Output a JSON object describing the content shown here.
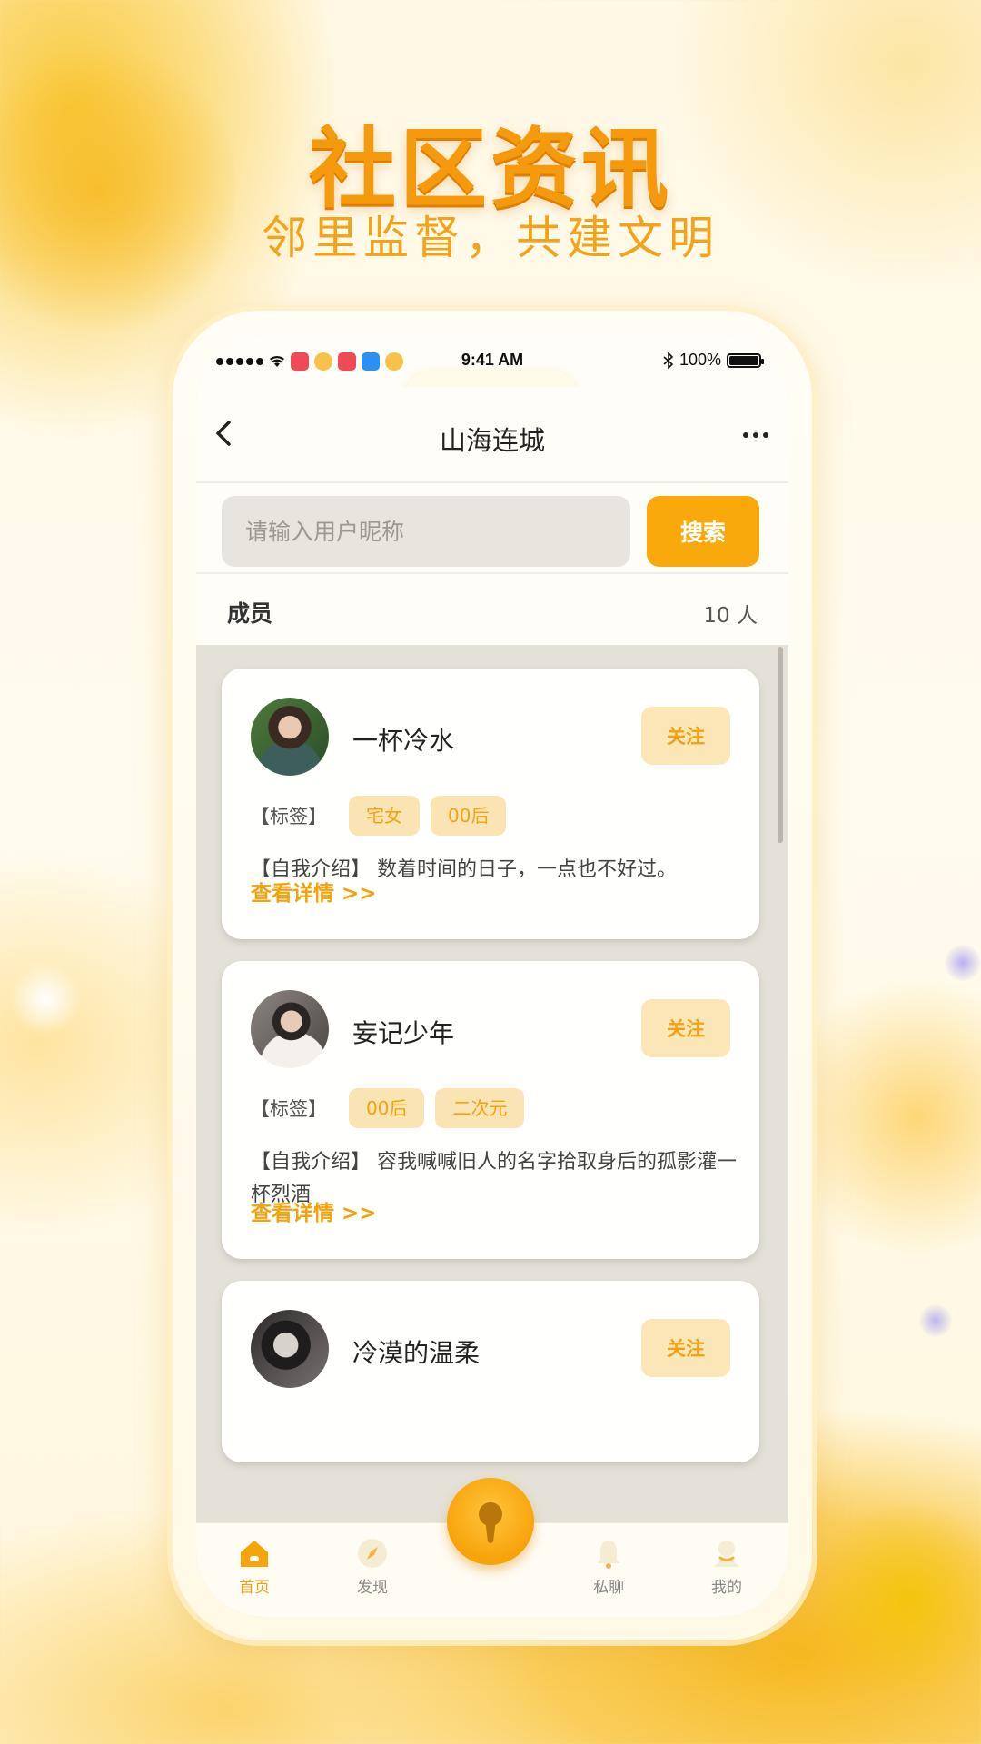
{
  "banner": {
    "title": "社区资讯",
    "subtitle": "邻里监督，共建文明"
  },
  "status_bar": {
    "time": "9:41 AM",
    "battery": "100%"
  },
  "nav": {
    "title": "山海连城"
  },
  "search": {
    "placeholder": "请输入用户昵称",
    "button_label": "搜索"
  },
  "members": {
    "title": "成员",
    "count": "10 人"
  },
  "cards": [
    {
      "name": "一杯冷水",
      "follow_label": "关注",
      "tag_label": "【标签】",
      "tags": [
        "宅女",
        "00后"
      ],
      "intro": "【自我介绍】 数着时间的日子，一点也不好过。",
      "detail_link": "查看详情 >>"
    },
    {
      "name": "妄记少年",
      "follow_label": "关注",
      "tag_label": "【标签】",
      "tags": [
        "00后",
        "二次元"
      ],
      "intro": "【自我介绍】 容我喊喊旧人的名字拾取身后的孤影灌一杯烈酒",
      "detail_link": "查看详情 >>"
    },
    {
      "name": "冷漠的温柔",
      "follow_label": "关注"
    }
  ],
  "tabbar": {
    "items": [
      {
        "label": "首页",
        "icon": "home-icon",
        "active": true
      },
      {
        "label": "发现",
        "icon": "compass-icon",
        "active": false
      },
      {
        "label": "私聊",
        "icon": "bell-icon",
        "active": false
      },
      {
        "label": "我的",
        "icon": "profile-icon",
        "active": false
      }
    ],
    "center_icon": "keyhole-icon"
  },
  "colors": {
    "accent": "#f9a90c",
    "accent_soft": "#fbe4b3",
    "background": "#fff8e4"
  }
}
